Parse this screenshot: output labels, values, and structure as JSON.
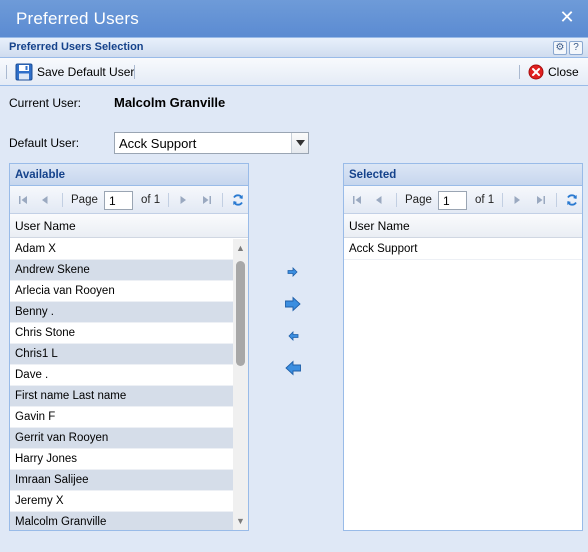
{
  "window": {
    "title": "Preferred Users",
    "subtitle": "Preferred Users Selection"
  },
  "toolbar": {
    "save_label": "Save Default User",
    "close_label": "Close"
  },
  "current_user": {
    "label": "Current User:",
    "value": "Malcolm Granville"
  },
  "default_user": {
    "label": "Default User:",
    "selected": "Acck Support"
  },
  "available": {
    "title": "Available",
    "pager": {
      "page_label": "Page",
      "page": "1",
      "of_label": "of 1"
    },
    "column": "User Name",
    "rows": [
      "Adam X",
      "Andrew Skene",
      "Arlecia van Rooyen",
      "Benny .",
      "Chris Stone",
      "Chris1 L",
      "Dave .",
      "First name Last name",
      "Gavin F",
      "Gerrit van Rooyen",
      "Harry Jones",
      "Imraan Salijee",
      "Jeremy X",
      "Malcolm Granville"
    ]
  },
  "selected": {
    "title": "Selected",
    "pager": {
      "page_label": "Page",
      "page": "1",
      "of_label": "of 1"
    },
    "column": "User Name",
    "rows": [
      "Acck Support"
    ]
  },
  "colors": {
    "title_bar": "#5b8bd2",
    "header_text": "#15428b",
    "alt_row": "#d5dde9",
    "background": "#dfe8f6"
  }
}
